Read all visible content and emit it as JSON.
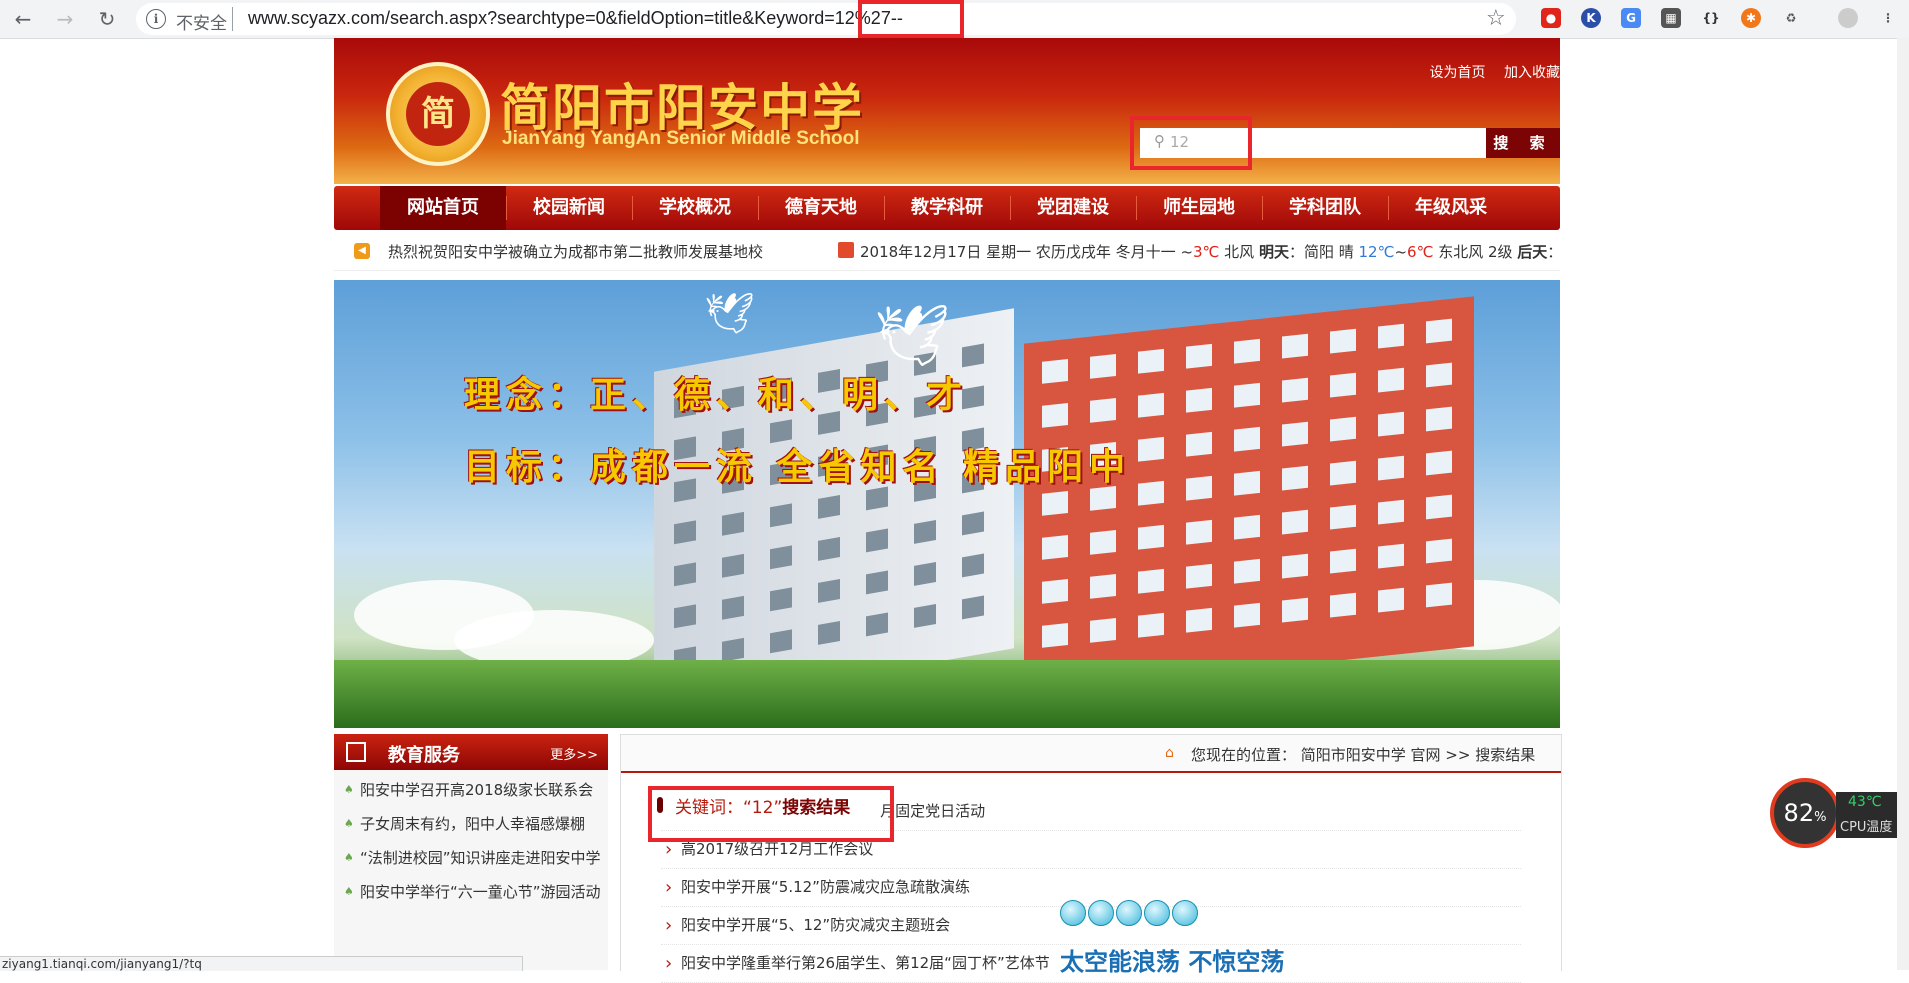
{
  "browser": {
    "insecure_label": "不安全",
    "url": "www.scyazx.com/search.aspx?searchtype=0&fieldOption=title&Keyword=12%27--",
    "status_url": "ziyang1.tianqi.com/jianyang1/?tq"
  },
  "site": {
    "logo_text": "简",
    "name_cn": "简阳市阳安中学",
    "name_en": "JianYang YangAn Senior Middle School",
    "top_links": [
      "设为首页",
      "加入收藏"
    ],
    "search_value": "12",
    "search_button": "搜 索"
  },
  "nav": [
    "网站首页",
    "校园新闻",
    "学校概况",
    "德育天地",
    "教学科研",
    "党团建设",
    "师生园地",
    "学科团队",
    "年级风采"
  ],
  "ticker": {
    "news": "热烈祝贺阳安中学被确立为成都市第二批教师发展基地校",
    "date": "2018年12月17日  星期一  农历戊戌年  冬月十一",
    "weather_a": "~",
    "temp_low": "3℃",
    "weather_b": " 北风 ",
    "tomorrow_label": "明天",
    "weather_c": "：简阳 晴 ",
    "temp_hi": "12℃",
    "weather_d": "~",
    "temp_low2": "6℃",
    "weather_e": " 东北风 2级 ",
    "after_label": "后天",
    "weather_f": "："
  },
  "hero": {
    "slogan1": "理念：正、德、和、明、才",
    "slogan2": "目标：成都一流  全省知名  精品阳中"
  },
  "sidebar": {
    "title": "教育服务",
    "more": "更多>>",
    "items": [
      "阳安中学召开高2018级家长联系会",
      "子女周末有约，阳中人幸福感爆棚",
      "“法制进校园”知识讲座走进阳安中学",
      "阳安中学举行“六一童心节”游园活动"
    ]
  },
  "main": {
    "breadcrumb": "您现在的位置： 简阳市阳安中学 官网  >> 搜索结果",
    "kw_label": "关键词：“12”",
    "kw_result": "搜索结果",
    "results": [
      "阳安中学高中第三支部开展12月固定党日活动",
      "高2017级召开12月工作会议",
      "阳安中学开展“5.12”防震减灾应急疏散演练",
      "阳安中学开展“5、12”防灾减灾主题班会",
      "阳安中学隆重举行第26届学生、第12届“园丁杯”艺体节"
    ]
  },
  "overlay": {
    "text": "太空能浪荡  不惊空荡",
    "cpu_value": "82",
    "cpu_unit": "%",
    "cpu_temp": "43℃",
    "cpu_label": "CPU温度"
  },
  "colors": {
    "brand_red": "#b51a0c",
    "highlight": "#e8262b"
  }
}
